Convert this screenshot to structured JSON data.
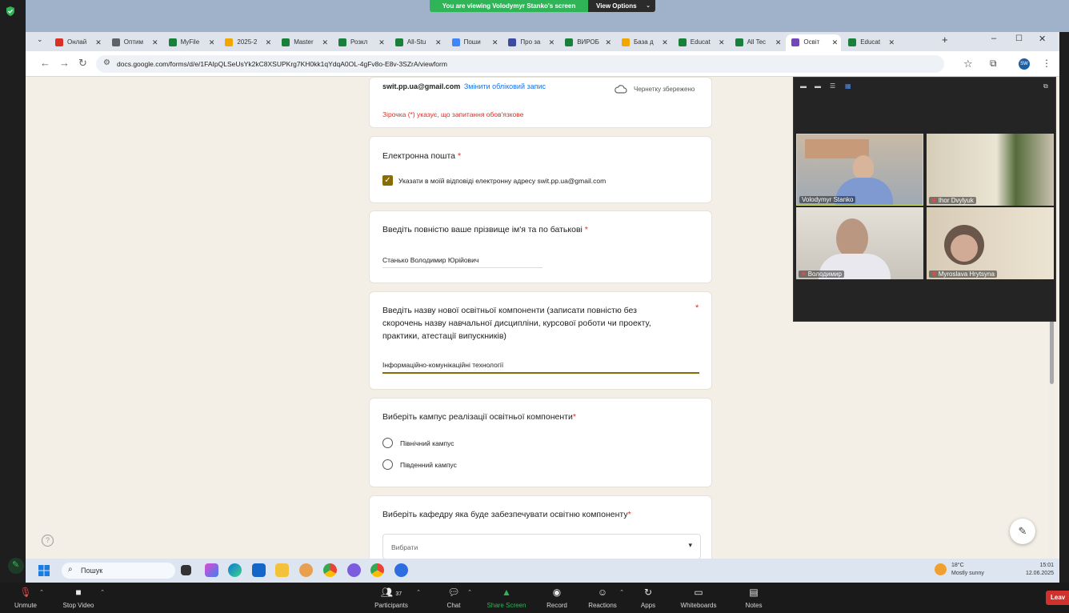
{
  "zoom": {
    "share_banner": "You are viewing Volodymyr Stanko's screen",
    "view_options": "View Options",
    "controls": [
      {
        "label": "Unmute",
        "icon": "mic-off-icon"
      },
      {
        "label": "Stop Video",
        "icon": "video-icon"
      },
      {
        "label": "Participants",
        "icon": "participants-icon",
        "count": "37"
      },
      {
        "label": "Chat",
        "icon": "chat-icon"
      },
      {
        "label": "Share Screen",
        "icon": "share-screen-icon"
      },
      {
        "label": "Record",
        "icon": "record-icon"
      },
      {
        "label": "Reactions",
        "icon": "reactions-icon"
      },
      {
        "label": "Apps",
        "icon": "apps-icon"
      },
      {
        "label": "Whiteboards",
        "icon": "whiteboard-icon"
      },
      {
        "label": "Notes",
        "icon": "notes-icon"
      }
    ],
    "leave": "Leav",
    "gallery": [
      {
        "name": "Volodymyr Stanko",
        "muted": false,
        "active": true
      },
      {
        "name": "Ihor Dvylyuk",
        "muted": true,
        "active": false
      },
      {
        "name": "Володимир",
        "muted": true,
        "active": false
      },
      {
        "name": "Myroslava Hrytsyna",
        "muted": true,
        "active": false
      }
    ]
  },
  "browser": {
    "tabs": [
      {
        "label": "Онлай",
        "color": "#d93025"
      },
      {
        "label": "Оптим",
        "color": "#5f6368"
      },
      {
        "label": "MyFile",
        "color": "#188038"
      },
      {
        "label": "2025-2",
        "color": "#f2a600"
      },
      {
        "label": "Master",
        "color": "#188038"
      },
      {
        "label": "Розкл",
        "color": "#188038"
      },
      {
        "label": "All-Stu",
        "color": "#188038"
      },
      {
        "label": "Поши",
        "color": "#4285f4"
      },
      {
        "label": "Про за",
        "color": "#3c4ba0"
      },
      {
        "label": "ВИРОБ",
        "color": "#188038"
      },
      {
        "label": "База д",
        "color": "#f2a600"
      },
      {
        "label": "Educat",
        "color": "#188038"
      },
      {
        "label": "All Tec",
        "color": "#188038"
      },
      {
        "label": "Освіт",
        "color": "#7248b9"
      },
      {
        "label": "Educat",
        "color": "#188038"
      }
    ],
    "url": "docs.google.com/forms/d/e/1FAIpQLSeUsYk2kC8XSUPKrg7KH0kk1qYdqA0OL-4gFv8o-E8v-3SZrA/viewform"
  },
  "form": {
    "account_email": "swit.pp.ua@gmail.com",
    "switch_account": "Змінити обліковий запис",
    "draft_saved": "Чернетку збережено",
    "required_note": "Зірочка (*) указує, що запитання обов'язкове",
    "email_section": {
      "title": "Електронна пошта",
      "checkbox_label": "Указати в моїй відповіді електронну адресу swit.pp.ua@gmail.com",
      "checked": true
    },
    "q_name": {
      "title": "Введіть повністю ваше прізвище ім'я та по батькові",
      "value": "Станько Володимир Юрійович"
    },
    "q_component": {
      "title_lines": [
        "Введіть назву нової освітньої компоненти (записати повністю без",
        "скорочень назву навчальної дисципліни, курсової роботи чи проекту,",
        "практики, атестації випускників)"
      ],
      "value": "Інформаційно-комунікаційні технології"
    },
    "q_campus": {
      "title": "Виберіть кампус реалізації освітньої компоненти",
      "options": [
        "Північний кампус",
        "Південний кампус"
      ]
    },
    "q_department": {
      "title": "Виберіть кафедру яка буде забезпечувати освітню компоненту",
      "placeholder": "Вибрати"
    }
  },
  "taskbar": {
    "search": "Пошук",
    "weather_temp": "18°C",
    "weather_desc": "Mostly sunny",
    "time": "15:01",
    "date": "12.06.2025"
  },
  "colors": {
    "accent_green": "#2fb457",
    "form_bg": "#f3efe6",
    "required_red": "#d93025",
    "checkbox": "#8a6d00",
    "focus_underline": "#8a6d00"
  }
}
